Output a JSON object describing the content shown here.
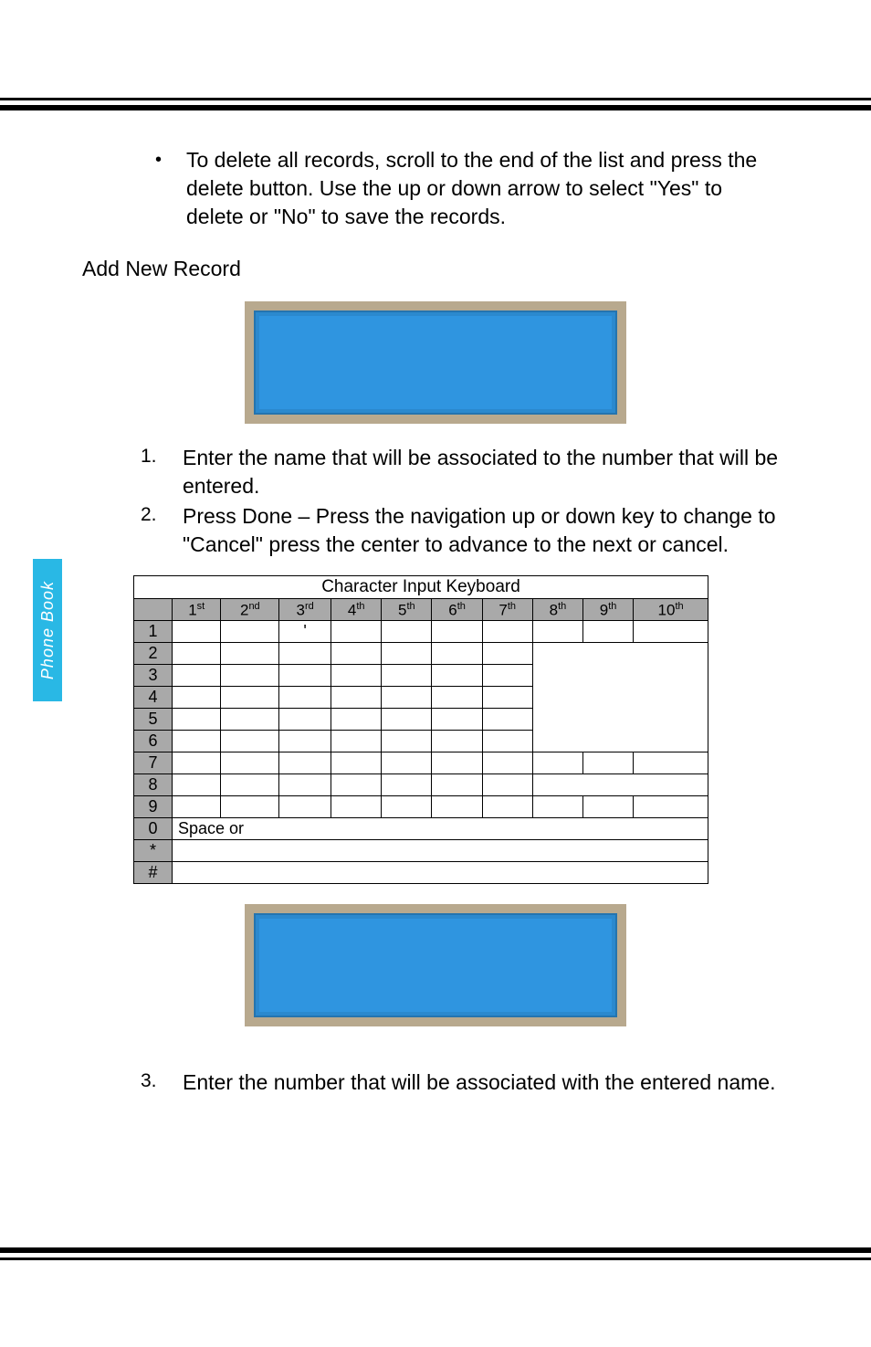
{
  "side_tab": {
    "label": "Phone Book"
  },
  "bullet": {
    "marker": "•",
    "text": "To delete all records, scroll to the end of the list and press the delete button. Use the up or down arrow to select \"Yes\" to delete or \"No\" to save the records."
  },
  "heading_add": "Add New Record",
  "steps_a": [
    {
      "n": "1.",
      "t": "Enter the name that will be associated to the number that will be entered."
    },
    {
      "n": "2.",
      "t": "Press Done – Press the navigation up or down key to change to \"Cancel\" press the center to advance to the next or cancel."
    }
  ],
  "table": {
    "title": "Character Input Keyboard",
    "headers": [
      "",
      "1st",
      "2nd",
      "3rd",
      "4th",
      "5th",
      "6th",
      "7th",
      "8th",
      "9th",
      "10th"
    ],
    "rows": [
      {
        "key": "1",
        "cells": [
          "",
          "",
          "'",
          "",
          "",
          "",
          "",
          "",
          "",
          ""
        ]
      },
      {
        "key": "2",
        "cells": [
          "",
          "",
          "",
          "",
          "",
          "",
          "",
          "",
          "",
          ""
        ]
      },
      {
        "key": "3",
        "cells": [
          "",
          "",
          "",
          "",
          "",
          "",
          "",
          "",
          "",
          ""
        ]
      },
      {
        "key": "4",
        "cells": [
          "",
          "",
          "",
          "",
          "",
          "",
          "",
          "",
          "",
          ""
        ]
      },
      {
        "key": "5",
        "cells": [
          "",
          "",
          "",
          "",
          "",
          "",
          "",
          "",
          "",
          ""
        ]
      },
      {
        "key": "6",
        "cells": [
          "",
          "",
          "",
          "",
          "",
          "",
          "",
          "",
          "",
          ""
        ]
      },
      {
        "key": "7",
        "cells": [
          "",
          "",
          "",
          "",
          "",
          "",
          "",
          "",
          "",
          ""
        ]
      },
      {
        "key": "8",
        "cells": [
          "",
          "",
          "",
          "",
          "",
          "",
          "",
          "",
          "",
          ""
        ]
      },
      {
        "key": "9",
        "cells": [
          "",
          "",
          "",
          "",
          "",
          "",
          "",
          "",
          "",
          ""
        ]
      },
      {
        "key": "0",
        "span": "Space or"
      },
      {
        "key": "*",
        "span": ""
      },
      {
        "key": "#",
        "span": ""
      }
    ]
  },
  "step3": {
    "n": "3.",
    "t": "Enter the number that will be associated with the entered name."
  }
}
